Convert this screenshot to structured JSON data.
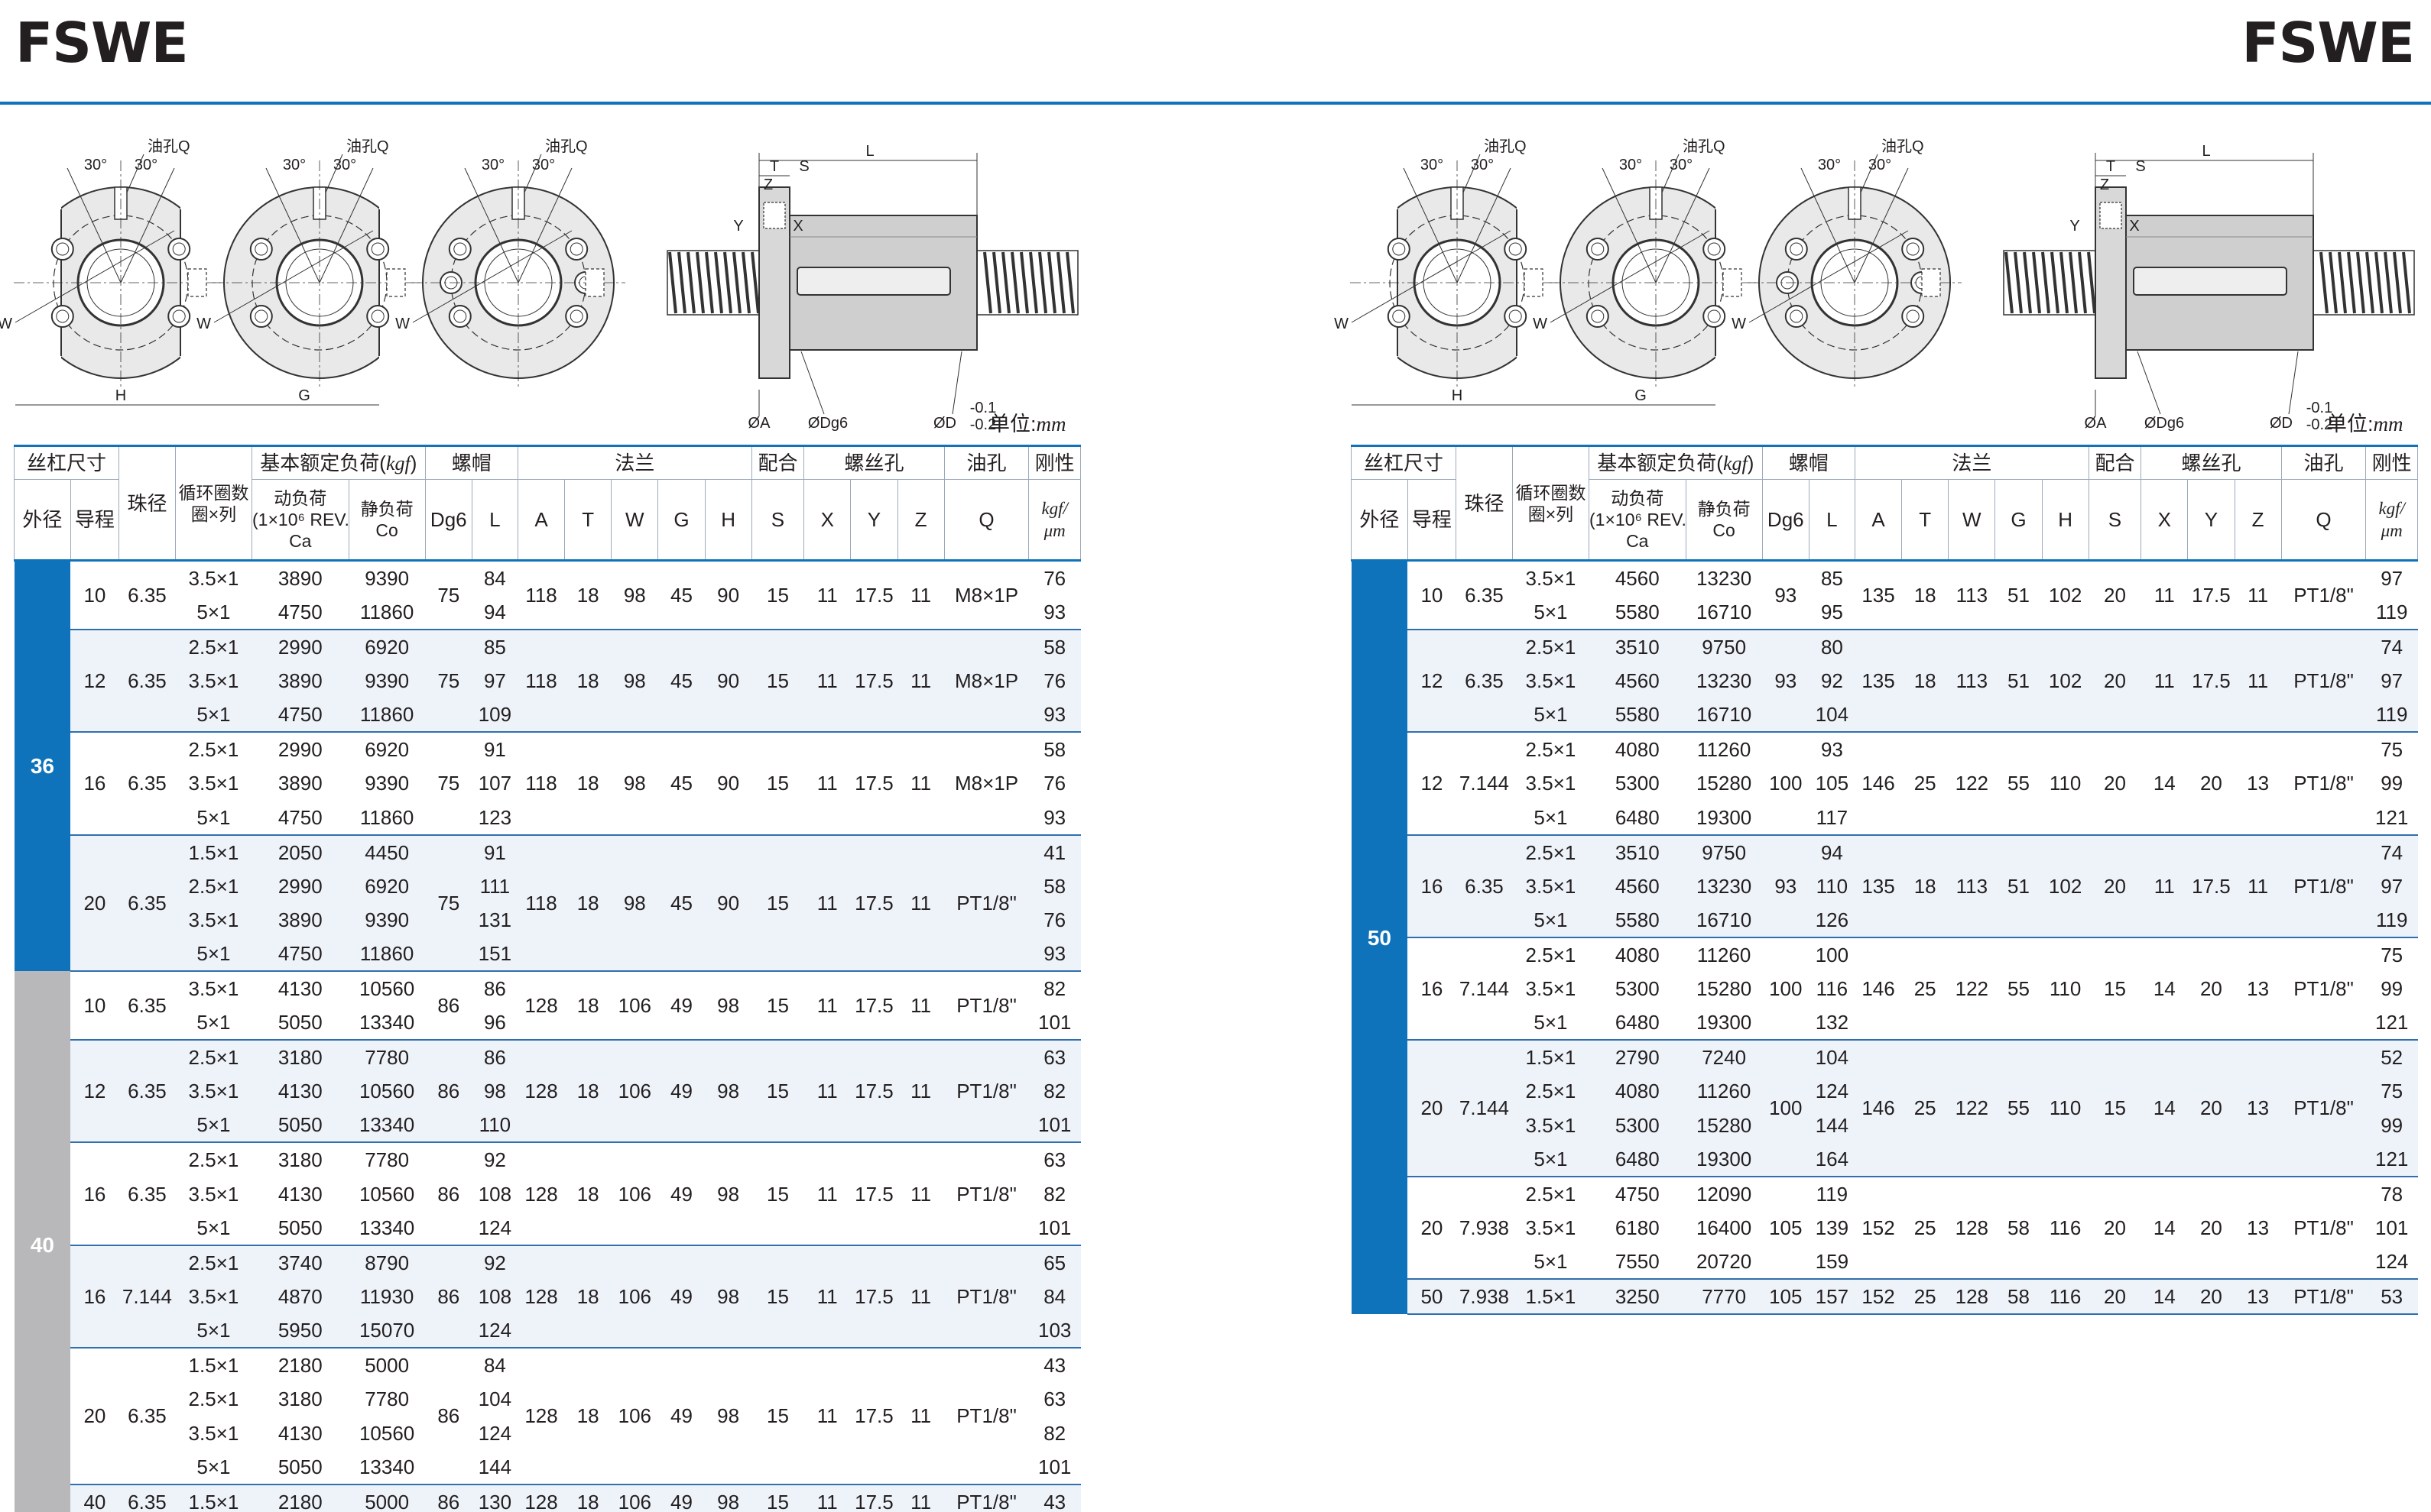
{
  "page": {
    "title_left": "FSWE",
    "title_right": "FSWE",
    "unit_prefix": "单位:",
    "unit_value": "mm"
  },
  "drawing": {
    "oil_hole": "油孔Q",
    "angle": "30°",
    "w": "W",
    "h": "H",
    "g": "G",
    "l": "L",
    "t": "T",
    "s": "S",
    "z": "Z",
    "y": "Y",
    "x": "X",
    "phi_a": "ØA",
    "phi_dg6": "ØDg6",
    "phi_d": "ØD",
    "tol": "-0.1",
    "tol2": "-0.2"
  },
  "table_header": {
    "screw_size": "丝杠尺寸",
    "ball_dia": "珠径",
    "circuits": "循环圈数圈×列",
    "rated_load": "基本额定负荷(",
    "rated_load_unit": "kgf",
    "rated_load_close": ")",
    "nut": "螺帽",
    "flange": "法兰",
    "fit": "配合",
    "bolt_hole": "螺丝孔",
    "oil_hole": "油孔",
    "stiffness": "刚性",
    "od": "外径",
    "lead": "导程",
    "dynamic_1": "动负荷",
    "dynamic_2": "(1×10⁶ REV.)",
    "dynamic_3": "Ca",
    "static_1": "静负荷",
    "static_2": "Co",
    "dg6": "Dg6",
    "l": "L",
    "a": "A",
    "t": "T",
    "w": "W",
    "g": "G",
    "h": "H",
    "s": "S",
    "x": "X",
    "y": "Y",
    "z": "Z",
    "q": "Q",
    "stiff_unit_1": "kgf/",
    "stiff_unit_2": "μm"
  },
  "left_table": {
    "outer_groups": [
      {
        "od": "36",
        "color": "blue",
        "groups": [
          {
            "lead": "10",
            "ball": "6.35",
            "Dg6": "75",
            "A": "118",
            "T": "18",
            "W": "98",
            "G": "45",
            "H": "90",
            "S": "15",
            "X": "11",
            "Y": "17.5",
            "Z": "11",
            "Q": "M8×1P",
            "rows": [
              [
                "3.5×1",
                "3890",
                "9390",
                "84",
                "76"
              ],
              [
                "5×1",
                "4750",
                "11860",
                "94",
                "93"
              ]
            ]
          },
          {
            "lead": "12",
            "ball": "6.35",
            "Dg6": "75",
            "A": "118",
            "T": "18",
            "W": "98",
            "G": "45",
            "H": "90",
            "S": "15",
            "X": "11",
            "Y": "17.5",
            "Z": "11",
            "Q": "M8×1P",
            "rows": [
              [
                "2.5×1",
                "2990",
                "6920",
                "85",
                "58"
              ],
              [
                "3.5×1",
                "3890",
                "9390",
                "97",
                "76"
              ],
              [
                "5×1",
                "4750",
                "11860",
                "109",
                "93"
              ]
            ]
          },
          {
            "lead": "16",
            "ball": "6.35",
            "Dg6": "75",
            "A": "118",
            "T": "18",
            "W": "98",
            "G": "45",
            "H": "90",
            "S": "15",
            "X": "11",
            "Y": "17.5",
            "Z": "11",
            "Q": "M8×1P",
            "rows": [
              [
                "2.5×1",
                "2990",
                "6920",
                "91",
                "58"
              ],
              [
                "3.5×1",
                "3890",
                "9390",
                "107",
                "76"
              ],
              [
                "5×1",
                "4750",
                "11860",
                "123",
                "93"
              ]
            ]
          },
          {
            "lead": "20",
            "ball": "6.35",
            "Dg6": "75",
            "A": "118",
            "T": "18",
            "W": "98",
            "G": "45",
            "H": "90",
            "S": "15",
            "X": "11",
            "Y": "17.5",
            "Z": "11",
            "Q": "PT1/8\"",
            "rows": [
              [
                "1.5×1",
                "2050",
                "4450",
                "91",
                "41"
              ],
              [
                "2.5×1",
                "2990",
                "6920",
                "111",
                "58"
              ],
              [
                "3.5×1",
                "3890",
                "9390",
                "131",
                "76"
              ],
              [
                "5×1",
                "4750",
                "11860",
                "151",
                "93"
              ]
            ]
          }
        ]
      },
      {
        "od": "40",
        "color": "gray",
        "groups": [
          {
            "lead": "10",
            "ball": "6.35",
            "Dg6": "86",
            "A": "128",
            "T": "18",
            "W": "106",
            "G": "49",
            "H": "98",
            "S": "15",
            "X": "11",
            "Y": "17.5",
            "Z": "11",
            "Q": "PT1/8\"",
            "rows": [
              [
                "3.5×1",
                "4130",
                "10560",
                "86",
                "82"
              ],
              [
                "5×1",
                "5050",
                "13340",
                "96",
                "101"
              ]
            ]
          },
          {
            "lead": "12",
            "ball": "6.35",
            "Dg6": "86",
            "A": "128",
            "T": "18",
            "W": "106",
            "G": "49",
            "H": "98",
            "S": "15",
            "X": "11",
            "Y": "17.5",
            "Z": "11",
            "Q": "PT1/8\"",
            "rows": [
              [
                "2.5×1",
                "3180",
                "7780",
                "86",
                "63"
              ],
              [
                "3.5×1",
                "4130",
                "10560",
                "98",
                "82"
              ],
              [
                "5×1",
                "5050",
                "13340",
                "110",
                "101"
              ]
            ]
          },
          {
            "lead": "16",
            "ball": "6.35",
            "Dg6": "86",
            "A": "128",
            "T": "18",
            "W": "106",
            "G": "49",
            "H": "98",
            "S": "15",
            "X": "11",
            "Y": "17.5",
            "Z": "11",
            "Q": "PT1/8\"",
            "rows": [
              [
                "2.5×1",
                "3180",
                "7780",
                "92",
                "63"
              ],
              [
                "3.5×1",
                "4130",
                "10560",
                "108",
                "82"
              ],
              [
                "5×1",
                "5050",
                "13340",
                "124",
                "101"
              ]
            ]
          },
          {
            "lead": "16",
            "ball": "7.144",
            "Dg6": "86",
            "A": "128",
            "T": "18",
            "W": "106",
            "G": "49",
            "H": "98",
            "S": "15",
            "X": "11",
            "Y": "17.5",
            "Z": "11",
            "Q": "PT1/8\"",
            "rows": [
              [
                "2.5×1",
                "3740",
                "8790",
                "92",
                "65"
              ],
              [
                "3.5×1",
                "4870",
                "11930",
                "108",
                "84"
              ],
              [
                "5×1",
                "5950",
                "15070",
                "124",
                "103"
              ]
            ]
          },
          {
            "lead": "20",
            "ball": "6.35",
            "Dg6": "86",
            "A": "128",
            "T": "18",
            "W": "106",
            "G": "49",
            "H": "98",
            "S": "15",
            "X": "11",
            "Y": "17.5",
            "Z": "11",
            "Q": "PT1/8\"",
            "rows": [
              [
                "1.5×1",
                "2180",
                "5000",
                "84",
                "43"
              ],
              [
                "2.5×1",
                "3180",
                "7780",
                "104",
                "63"
              ],
              [
                "3.5×1",
                "4130",
                "10560",
                "124",
                "82"
              ],
              [
                "5×1",
                "5050",
                "13340",
                "144",
                "101"
              ]
            ]
          },
          {
            "lead": "40",
            "ball": "6.35",
            "Dg6": "86",
            "A": "128",
            "T": "18",
            "W": "106",
            "G": "49",
            "H": "98",
            "S": "15",
            "X": "11",
            "Y": "17.5",
            "Z": "11",
            "Q": "PT1/8\"",
            "rows": [
              [
                "1.5×1",
                "2180",
                "5000",
                "130",
                "43"
              ]
            ]
          }
        ]
      }
    ]
  },
  "right_table": {
    "outer_groups": [
      {
        "od": "50",
        "color": "blue",
        "groups": [
          {
            "lead": "10",
            "ball": "6.35",
            "Dg6": "93",
            "A": "135",
            "T": "18",
            "W": "113",
            "G": "51",
            "H": "102",
            "S": "20",
            "X": "11",
            "Y": "17.5",
            "Z": "11",
            "Q": "PT1/8\"",
            "rows": [
              [
                "3.5×1",
                "4560",
                "13230",
                "85",
                "97"
              ],
              [
                "5×1",
                "5580",
                "16710",
                "95",
                "119"
              ]
            ]
          },
          {
            "lead": "12",
            "ball": "6.35",
            "Dg6": "93",
            "A": "135",
            "T": "18",
            "W": "113",
            "G": "51",
            "H": "102",
            "S": "20",
            "X": "11",
            "Y": "17.5",
            "Z": "11",
            "Q": "PT1/8\"",
            "rows": [
              [
                "2.5×1",
                "3510",
                "9750",
                "80",
                "74"
              ],
              [
                "3.5×1",
                "4560",
                "13230",
                "92",
                "97"
              ],
              [
                "5×1",
                "5580",
                "16710",
                "104",
                "119"
              ]
            ]
          },
          {
            "lead": "12",
            "ball": "7.144",
            "Dg6": "100",
            "A": "146",
            "T": "25",
            "W": "122",
            "G": "55",
            "H": "110",
            "S": "20",
            "X": "14",
            "Y": "20",
            "Z": "13",
            "Q": "PT1/8\"",
            "rows": [
              [
                "2.5×1",
                "4080",
                "11260",
                "93",
                "75"
              ],
              [
                "3.5×1",
                "5300",
                "15280",
                "105",
                "99"
              ],
              [
                "5×1",
                "6480",
                "19300",
                "117",
                "121"
              ]
            ]
          },
          {
            "lead": "16",
            "ball": "6.35",
            "Dg6": "93",
            "A": "135",
            "T": "18",
            "W": "113",
            "G": "51",
            "H": "102",
            "S": "20",
            "X": "11",
            "Y": "17.5",
            "Z": "11",
            "Q": "PT1/8\"",
            "rows": [
              [
                "2.5×1",
                "3510",
                "9750",
                "94",
                "74"
              ],
              [
                "3.5×1",
                "4560",
                "13230",
                "110",
                "97"
              ],
              [
                "5×1",
                "5580",
                "16710",
                "126",
                "119"
              ]
            ]
          },
          {
            "lead": "16",
            "ball": "7.144",
            "Dg6": "100",
            "A": "146",
            "T": "25",
            "W": "122",
            "G": "55",
            "H": "110",
            "S": "15",
            "X": "14",
            "Y": "20",
            "Z": "13",
            "Q": "PT1/8\"",
            "rows": [
              [
                "2.5×1",
                "4080",
                "11260",
                "100",
                "75"
              ],
              [
                "3.5×1",
                "5300",
                "15280",
                "116",
                "99"
              ],
              [
                "5×1",
                "6480",
                "19300",
                "132",
                "121"
              ]
            ]
          },
          {
            "lead": "20",
            "ball": "7.144",
            "Dg6": "100",
            "A": "146",
            "T": "25",
            "W": "122",
            "G": "55",
            "H": "110",
            "S": "15",
            "X": "14",
            "Y": "20",
            "Z": "13",
            "Q": "PT1/8\"",
            "rows": [
              [
                "1.5×1",
                "2790",
                "7240",
                "104",
                "52"
              ],
              [
                "2.5×1",
                "4080",
                "11260",
                "124",
                "75"
              ],
              [
                "3.5×1",
                "5300",
                "15280",
                "144",
                "99"
              ],
              [
                "5×1",
                "6480",
                "19300",
                "164",
                "121"
              ]
            ]
          },
          {
            "lead": "20",
            "ball": "7.938",
            "Dg6": "105",
            "A": "152",
            "T": "25",
            "W": "128",
            "G": "58",
            "H": "116",
            "S": "20",
            "X": "14",
            "Y": "20",
            "Z": "13",
            "Q": "PT1/8\"",
            "rows": [
              [
                "2.5×1",
                "4750",
                "12090",
                "119",
                "78"
              ],
              [
                "3.5×1",
                "6180",
                "16400",
                "139",
                "101"
              ],
              [
                "5×1",
                "7550",
                "20720",
                "159",
                "124"
              ]
            ]
          },
          {
            "lead": "50",
            "ball": "7.938",
            "Dg6": "105",
            "A": "152",
            "T": "25",
            "W": "128",
            "G": "58",
            "H": "116",
            "S": "20",
            "X": "14",
            "Y": "20",
            "Z": "13",
            "Q": "PT1/8\"",
            "rows": [
              [
                "1.5×1",
                "3250",
                "7770",
                "157",
                "53"
              ]
            ]
          }
        ]
      }
    ]
  }
}
